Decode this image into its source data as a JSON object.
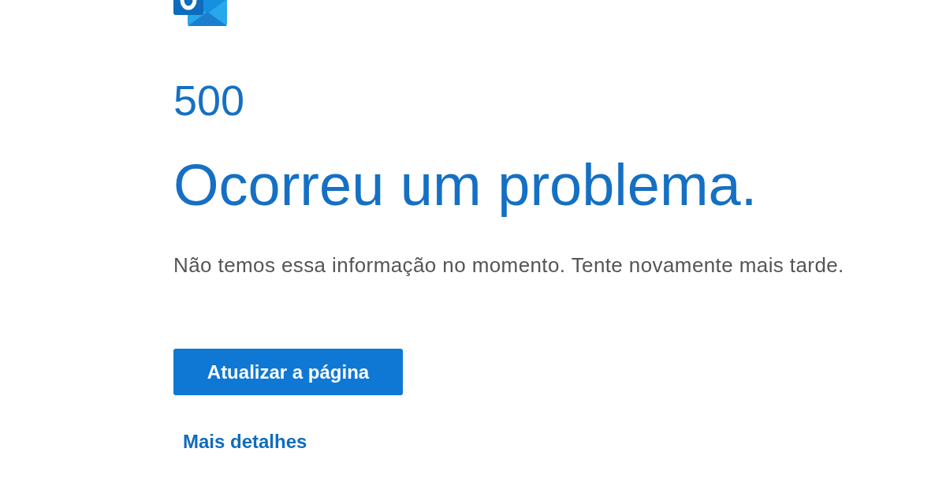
{
  "error_code": "500",
  "title": "Ocorreu um problema.",
  "message": "Não temos essa informação no momento. Tente novamente mais tarde.",
  "refresh_button": {
    "label": "Atualizar a página"
  },
  "details_link": {
    "label": "Mais detalhes"
  }
}
